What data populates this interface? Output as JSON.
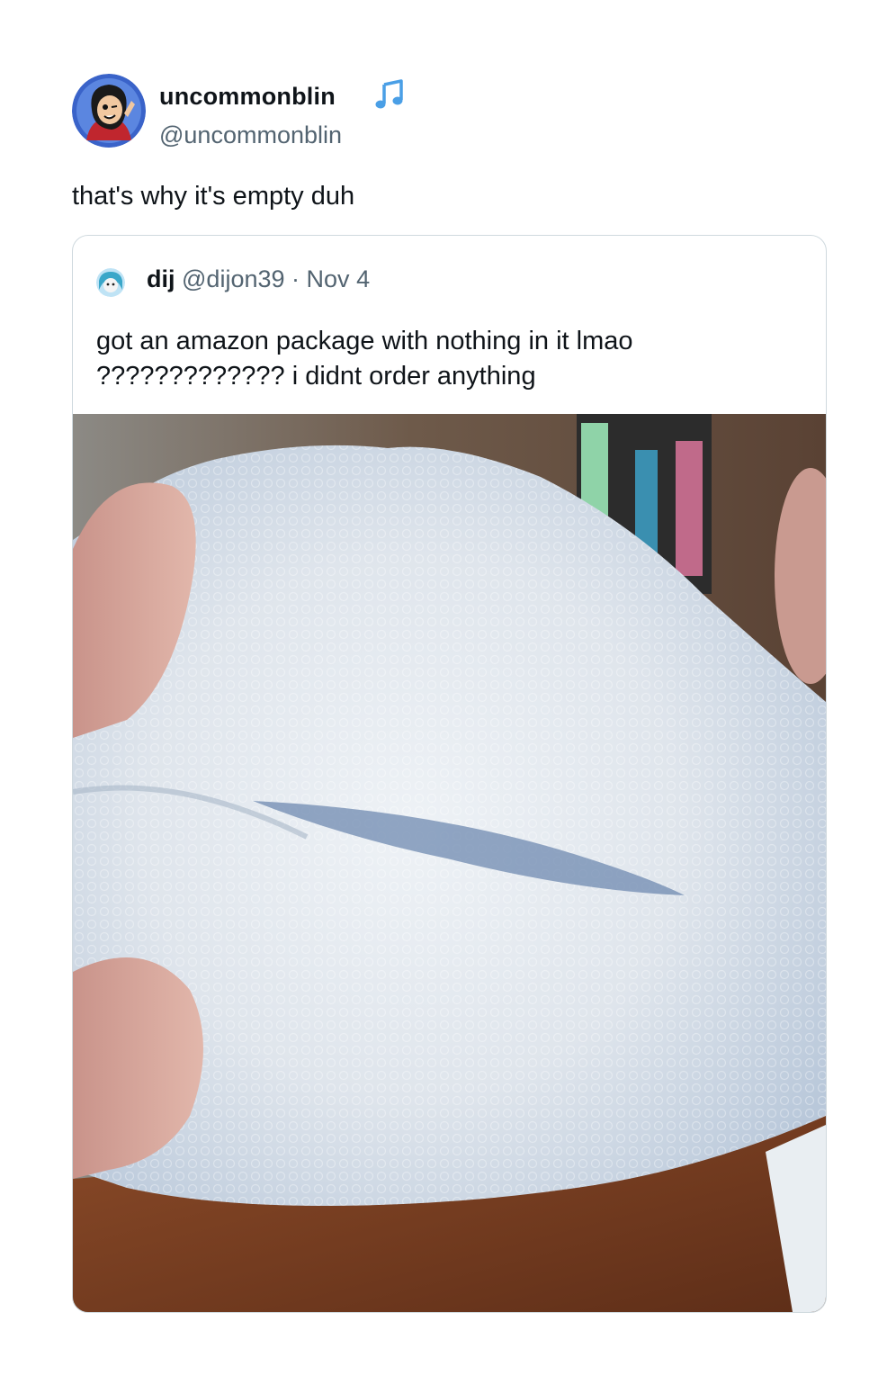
{
  "post": {
    "author": {
      "display_name": "uncommonblin",
      "handle": "@uncommonblin",
      "badge_icon": "music-note-icon"
    },
    "text": "that's why it's empty duh"
  },
  "quoted_post": {
    "author": {
      "display_name": "dij",
      "handle": "@dijon39"
    },
    "separator": "·",
    "date": "Nov 4",
    "text": "got an amazon package with nothing in it lmao\n????????????? i didnt order anything",
    "media": {
      "description_icon": "photo-image"
    }
  },
  "colors": {
    "text": "#0f1419",
    "secondary_text": "#536471",
    "border": "#cfd9de",
    "music_icon": "#4a9fe6"
  }
}
